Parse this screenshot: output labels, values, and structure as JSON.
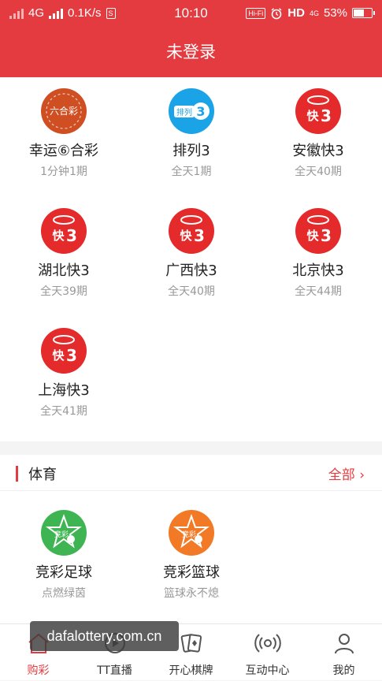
{
  "status_bar": {
    "network": "4G",
    "speed": "0.1K/s",
    "time": "10:10",
    "hifi": "Hi-Fi",
    "hd": "HD",
    "net4g": "4G",
    "battery": "53%"
  },
  "header": {
    "title": "未登录"
  },
  "lottery": {
    "games": [
      {
        "name": "幸运⑥合彩",
        "period": "1分钟1期",
        "icon": "liuhecai-logo-icon",
        "icon_text": "六合彩"
      },
      {
        "name": "排列3",
        "period": "全天1期",
        "icon": "pailie3-logo-icon",
        "icon_text": "排列"
      },
      {
        "name": "安徽快3",
        "period": "全天40期",
        "icon": "kuai3-logo-icon",
        "icon_text": "快"
      },
      {
        "name": "湖北快3",
        "period": "全天39期",
        "icon": "kuai3-logo-icon",
        "icon_text": "快"
      },
      {
        "name": "广西快3",
        "period": "全天40期",
        "icon": "kuai3-logo-icon",
        "icon_text": "快"
      },
      {
        "name": "北京快3",
        "period": "全天44期",
        "icon": "kuai3-logo-icon",
        "icon_text": "快"
      },
      {
        "name": "上海快3",
        "period": "全天41期",
        "icon": "kuai3-logo-icon",
        "icon_text": "快"
      }
    ]
  },
  "sports": {
    "title": "体育",
    "more": "全部 ›",
    "games": [
      {
        "name": "竞彩足球",
        "period": "点燃绿茵",
        "icon": "football-logo-icon",
        "icon_text": "竞彩"
      },
      {
        "name": "竞彩篮球",
        "period": "篮球永不熄",
        "icon": "basketball-logo-icon",
        "icon_text": "竞彩"
      }
    ]
  },
  "tabs": [
    {
      "label": "购彩",
      "icon": "home-icon",
      "active": true
    },
    {
      "label": "TT直播",
      "icon": "live-icon",
      "active": false
    },
    {
      "label": "开心棋牌",
      "icon": "cards-icon",
      "active": false
    },
    {
      "label": "互动中心",
      "icon": "broadcast-icon",
      "active": false
    },
    {
      "label": "我的",
      "icon": "user-icon",
      "active": false
    }
  ],
  "watermark": "dafalottery.com.cn",
  "colors": {
    "brand_red": "#e33b3f",
    "text_gray": "#999999"
  }
}
